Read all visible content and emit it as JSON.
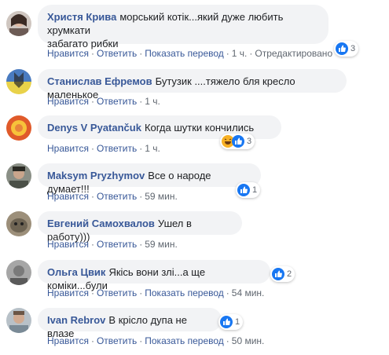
{
  "comments": [
    {
      "author": "Христя Крива",
      "text_line1": "морський котік...який дуже любить хрумкати",
      "text_line2": "забагато рибки",
      "actions": {
        "like": "Нравится",
        "reply": "Ответить",
        "translate": "Показать перевод",
        "time": "1 ч.",
        "edited": "Отредактировано"
      },
      "reaction_count": "3"
    },
    {
      "author": "Станислав Ефремов",
      "text": "Бутузик ....тяжело бля кресло маленькое",
      "actions": {
        "like": "Нравится",
        "reply": "Ответить",
        "time": "1 ч."
      }
    },
    {
      "author": "Denys V Pyatančuk",
      "text": "Когда шутки кончились",
      "actions": {
        "like": "Нравится",
        "reply": "Ответить",
        "time": "1 ч."
      },
      "reaction_count": "3"
    },
    {
      "author": "Maksym Pryzhymov",
      "text": "Все о народе думает!!!",
      "actions": {
        "like": "Нравится",
        "reply": "Ответить",
        "time": "59 мин."
      },
      "reaction_count": "1"
    },
    {
      "author": "Евгений Самохвалов",
      "text": "Ушел в работу)))",
      "actions": {
        "like": "Нравится",
        "reply": "Ответить",
        "time": "59 мин."
      }
    },
    {
      "author": "Ольга Цвик",
      "text": "Якісь вони злі...а ще коміки...були",
      "actions": {
        "like": "Нравится",
        "reply": "Ответить",
        "translate": "Показать перевод",
        "time": "54 мин."
      },
      "reaction_count": "2"
    },
    {
      "author": "Ivan Rebrov",
      "text": "В крісло дупа не влазе",
      "actions": {
        "like": "Нравится",
        "reply": "Ответить",
        "translate": "Показать перевод",
        "time": "50 мин."
      },
      "reaction_count": "1"
    }
  ],
  "colors": {
    "link": "#385898",
    "bubble": "#f2f3f5",
    "meta": "#606770",
    "like_blue": "#1877f2",
    "haha_yellow": "#f7b125"
  }
}
